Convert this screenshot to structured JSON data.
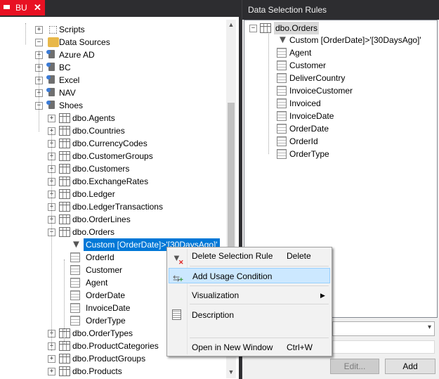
{
  "left_tab": {
    "label": "BU",
    "close": "✕"
  },
  "left_tree": [
    {
      "label": "Scripts",
      "icon": "script-icon",
      "exp": "+"
    },
    {
      "label": "Data Sources",
      "icon": "folder-icon",
      "exp": "−"
    },
    {
      "label": "Azure AD",
      "icon": "datasource-icon",
      "exp": "+"
    },
    {
      "label": "BC",
      "icon": "datasource-icon",
      "exp": "+"
    },
    {
      "label": "Excel",
      "icon": "datasource-icon",
      "exp": "+"
    },
    {
      "label": "NAV",
      "icon": "datasource-icon",
      "exp": "+"
    },
    {
      "label": "Shoes",
      "icon": "datasource-icon",
      "exp": "−"
    },
    {
      "label": "dbo.Agents",
      "icon": "table-icon",
      "exp": "+"
    },
    {
      "label": "dbo.Countries",
      "icon": "table-icon",
      "exp": "+"
    },
    {
      "label": "dbo.CurrencyCodes",
      "icon": "table-icon",
      "exp": "+"
    },
    {
      "label": "dbo.CustomerGroups",
      "icon": "table-icon",
      "exp": "+"
    },
    {
      "label": "dbo.Customers",
      "icon": "table-icon",
      "exp": "+"
    },
    {
      "label": "dbo.ExchangeRates",
      "icon": "table-icon",
      "exp": "+"
    },
    {
      "label": "dbo.Ledger",
      "icon": "table-icon",
      "exp": "+"
    },
    {
      "label": "dbo.LedgerTransactions",
      "icon": "table-icon",
      "exp": "+"
    },
    {
      "label": "dbo.OrderLines",
      "icon": "table-icon",
      "exp": "+"
    },
    {
      "label": "dbo.Orders",
      "icon": "table-icon",
      "exp": "−"
    },
    {
      "label": "Custom [OrderDate]>'[30DaysAgo]'",
      "icon": "filter-icon",
      "exp": ""
    },
    {
      "label": "OrderId",
      "icon": "key-column-icon",
      "exp": ""
    },
    {
      "label": "Customer",
      "icon": "column-icon",
      "exp": ""
    },
    {
      "label": "Agent",
      "icon": "column-icon",
      "exp": ""
    },
    {
      "label": "OrderDate",
      "icon": "column-icon",
      "exp": ""
    },
    {
      "label": "InvoiceDate",
      "icon": "column-icon",
      "exp": ""
    },
    {
      "label": "OrderType",
      "icon": "column-icon",
      "exp": ""
    },
    {
      "label": "dbo.OrderTypes",
      "icon": "table-icon",
      "exp": "+"
    },
    {
      "label": "dbo.ProductCategories",
      "icon": "table-icon",
      "exp": "+"
    },
    {
      "label": "dbo.ProductGroups",
      "icon": "table-icon",
      "exp": "+"
    },
    {
      "label": "dbo.Products",
      "icon": "table-icon",
      "exp": "+"
    }
  ],
  "right_panel": {
    "title": "Data Selection Rules",
    "root": {
      "label": "dbo.Orders",
      "exp": "−"
    },
    "items": [
      {
        "label": "Custom [OrderDate]>'[30DaysAgo]'",
        "icon": "filter-icon"
      },
      {
        "label": "Agent",
        "icon": "column-icon"
      },
      {
        "label": "Customer",
        "icon": "column-icon"
      },
      {
        "label": "DeliverCountry",
        "icon": "column-icon"
      },
      {
        "label": "InvoiceCustomer",
        "icon": "column-icon"
      },
      {
        "label": "Invoiced",
        "icon": "column-icon"
      },
      {
        "label": "InvoiceDate",
        "icon": "column-icon"
      },
      {
        "label": "OrderDate",
        "icon": "column-icon"
      },
      {
        "label": "OrderId",
        "icon": "key-column-icon"
      },
      {
        "label": "OrderType",
        "icon": "column-icon"
      }
    ],
    "edit_button": "Edit...",
    "add_button": "Add"
  },
  "context_menu": [
    {
      "label": "Delete Selection Rule",
      "shortcut": "Delete",
      "icon": "delete-filter-icon",
      "highlighted": false,
      "submenu": false
    },
    {
      "label": "Add Usage Condition",
      "shortcut": "",
      "icon": "add-condition-icon",
      "highlighted": true,
      "submenu": false
    },
    {
      "label": "Visualization",
      "shortcut": "",
      "icon": "",
      "highlighted": false,
      "submenu": true
    },
    {
      "label": "Description",
      "shortcut": "",
      "icon": "description-icon",
      "highlighted": false,
      "submenu": false
    },
    {
      "label": "Open in New Window",
      "shortcut": "Ctrl+W",
      "icon": "",
      "highlighted": false,
      "submenu": false
    }
  ],
  "colors": {
    "selection": "#0078d7",
    "tab_red": "#e81123",
    "menu_highlight": "#cce8ff"
  }
}
